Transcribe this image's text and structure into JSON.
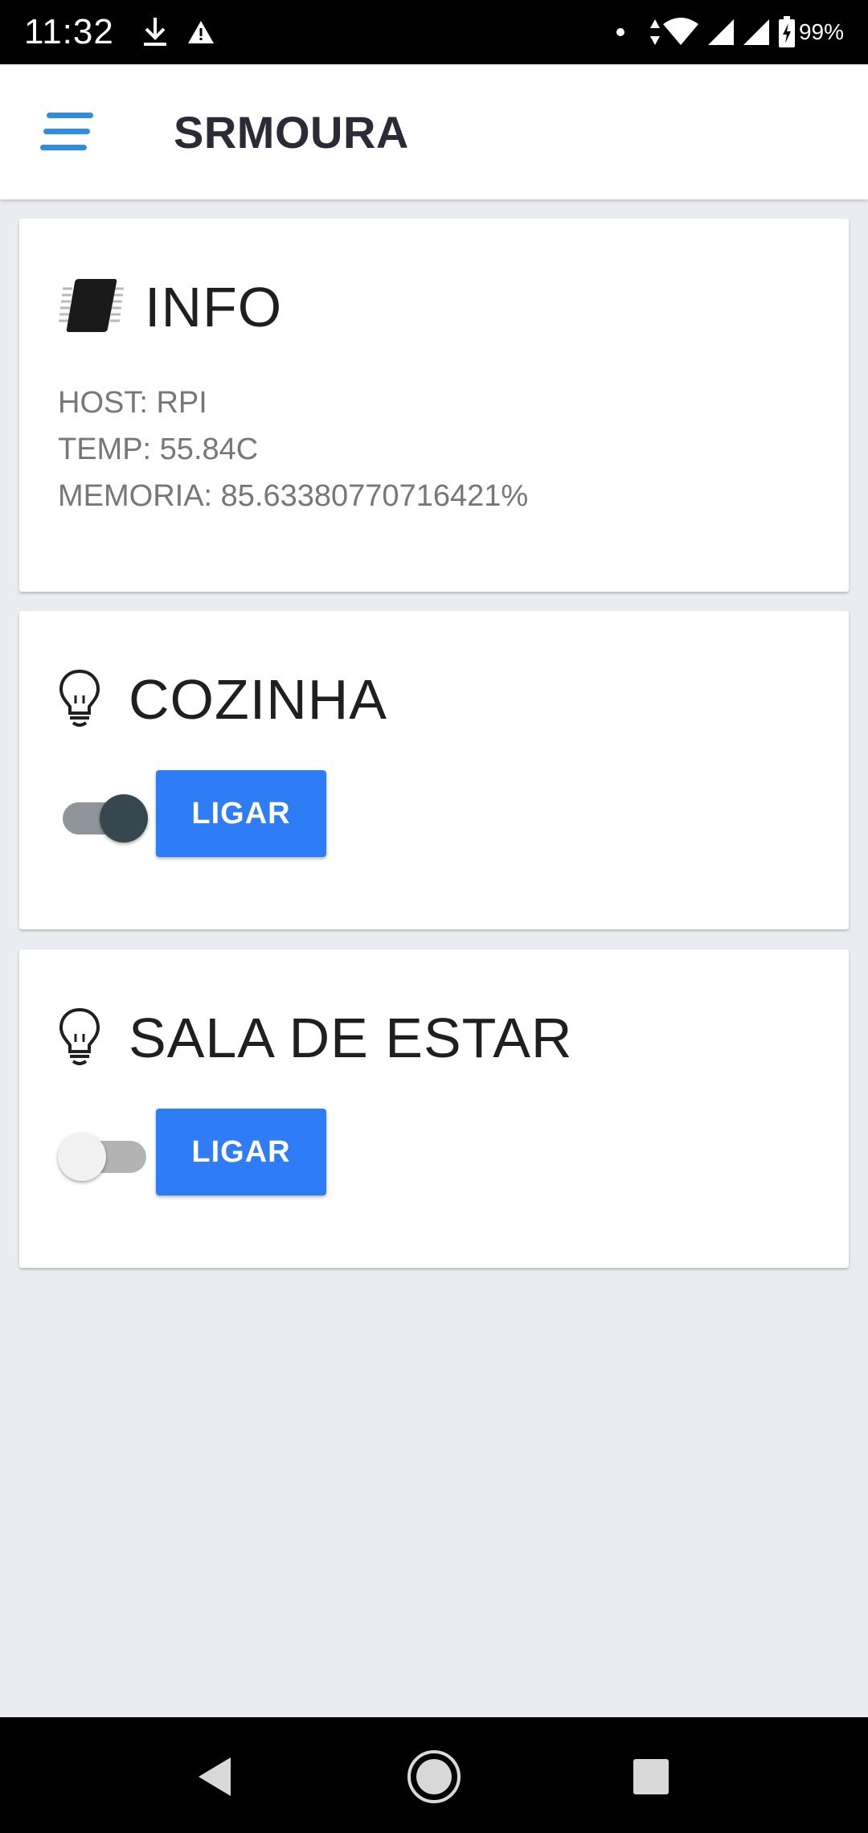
{
  "status_bar": {
    "time": "11:32",
    "battery": "99%",
    "icons": [
      "download-icon",
      "warning-icon",
      "dot-icon",
      "data-arrows-icon",
      "wifi-icon",
      "signal-icon",
      "signal-icon",
      "battery-charging-icon"
    ]
  },
  "app_bar": {
    "title": "SRMOURA",
    "menu_icon": "menu-icon",
    "accent_color": "#2f7df6"
  },
  "info_card": {
    "title": "INFO",
    "icon": "chip-icon",
    "lines": [
      "HOST: RPI",
      "TEMP: 55.84C",
      "MEMORIA: 85.63380770716421%"
    ]
  },
  "rooms": [
    {
      "title": "COZINHA",
      "icon": "lightbulb-icon",
      "switch_on": true,
      "button_label": "LIGAR"
    },
    {
      "title": "SALA DE ESTAR",
      "icon": "lightbulb-icon",
      "switch_on": false,
      "button_label": "LIGAR"
    }
  ],
  "colors": {
    "button": "#2f7df6",
    "background": "#e9ecf0",
    "switch_on_knob": "#37474f"
  },
  "nav_bar": {
    "icons": [
      "back-icon",
      "home-icon",
      "recent-apps-icon"
    ]
  }
}
